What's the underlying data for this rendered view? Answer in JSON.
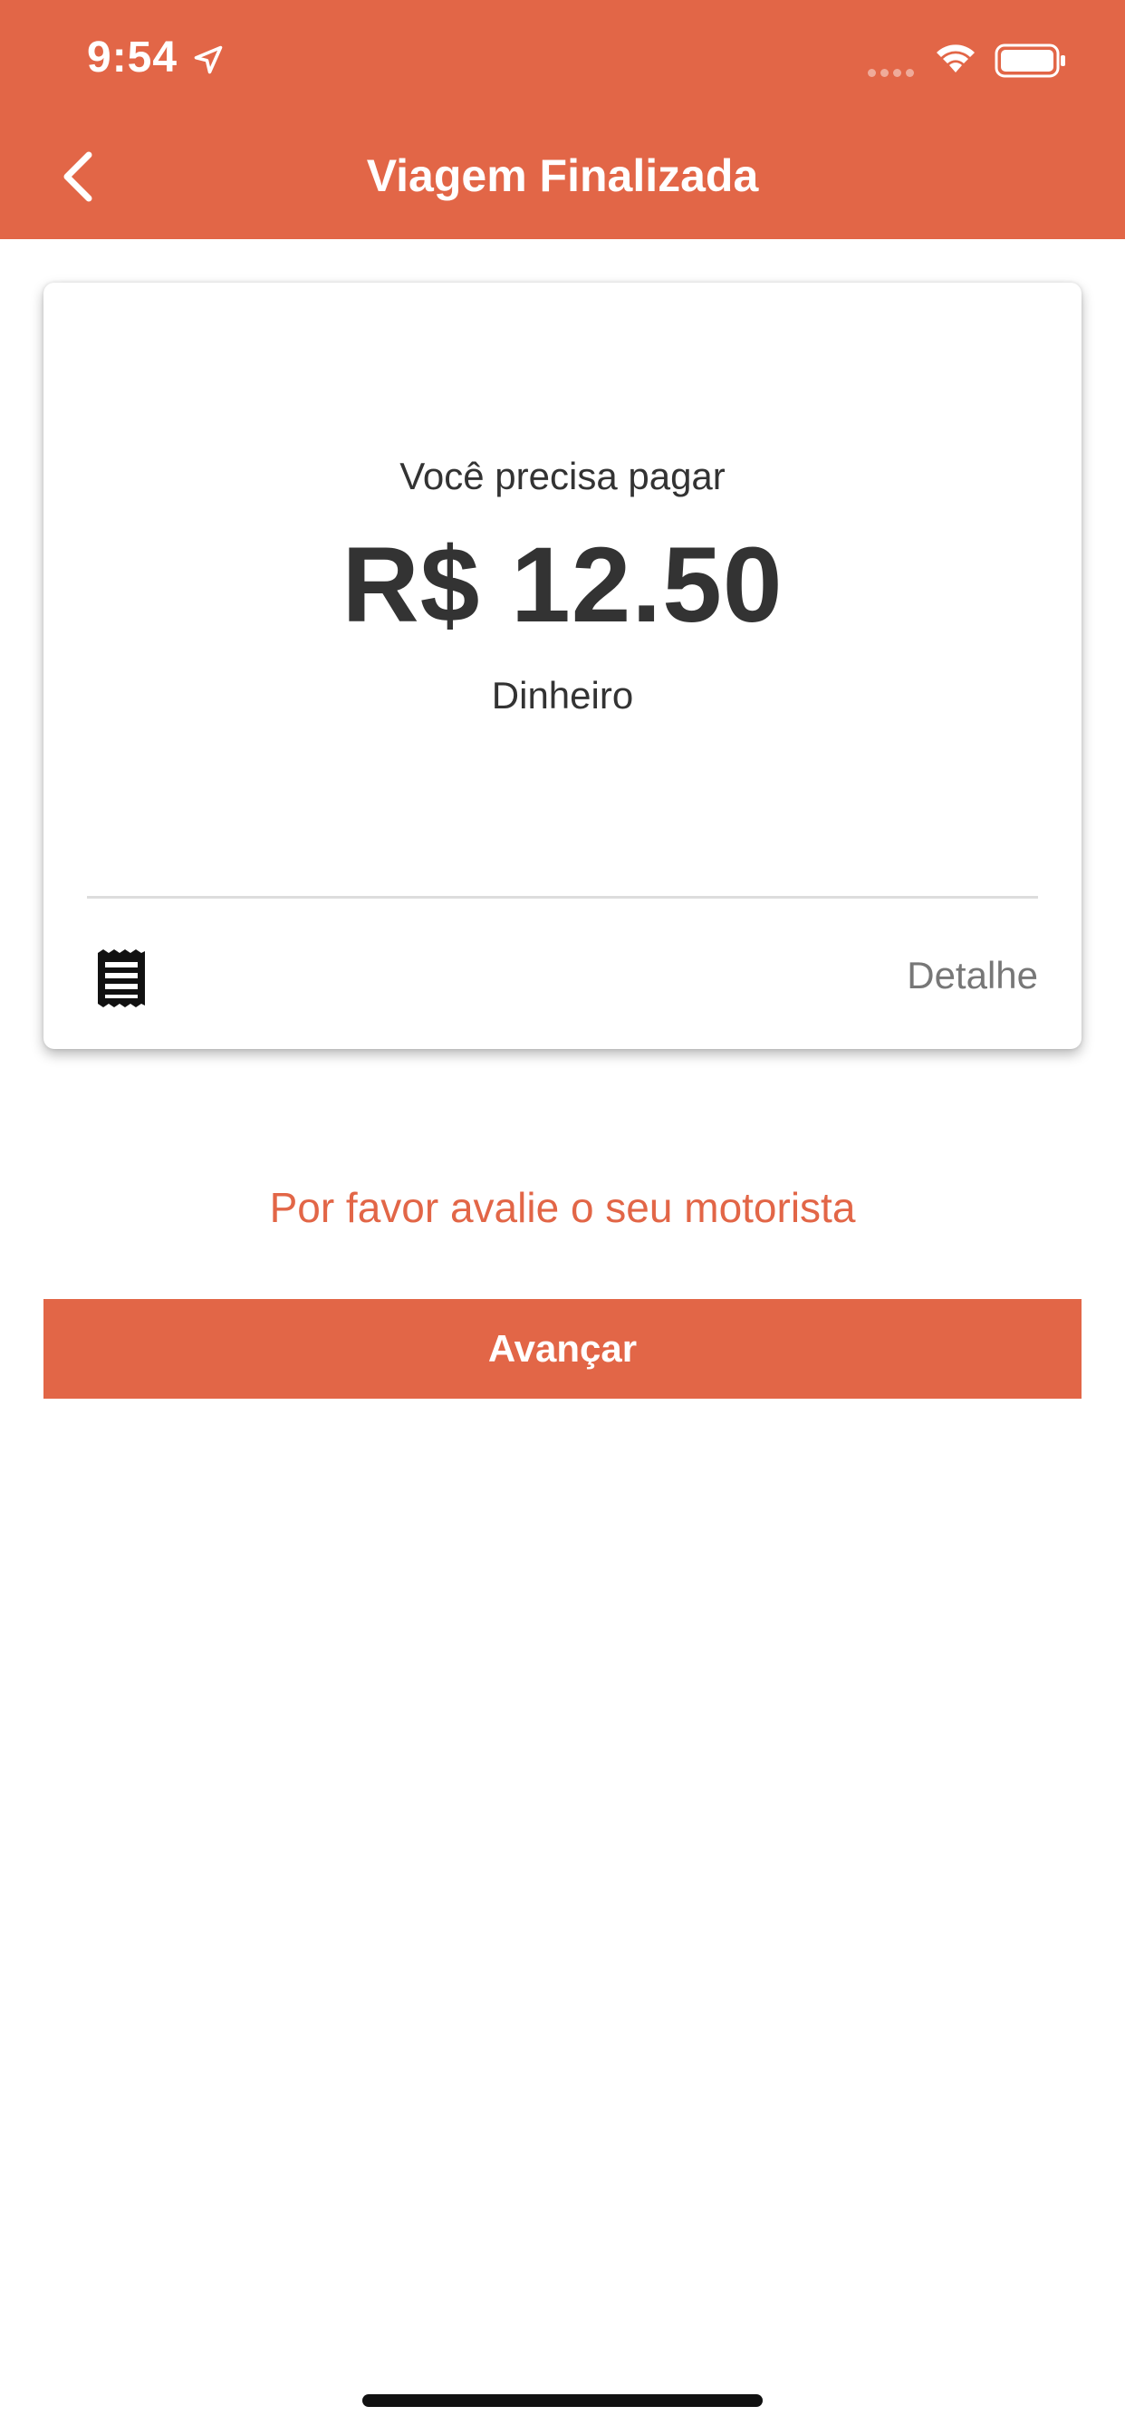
{
  "status_bar": {
    "time": "9:54",
    "location_icon": "location-arrow-icon",
    "wifi_icon": "wifi-icon",
    "battery_icon": "battery-icon"
  },
  "nav": {
    "title": "Viagem Finalizada",
    "back_icon": "chevron-left-icon"
  },
  "card": {
    "pay_label": "Você precisa pagar",
    "amount": "R$ 12.50",
    "method": "Dinheiro",
    "receipt_icon": "receipt-icon",
    "detail_label": "Detalhe"
  },
  "rate_prompt": "Por favor avalie o seu motorista",
  "next_button": "Avançar",
  "colors": {
    "accent": "#E26647",
    "text": "#333333",
    "muted": "#777777"
  }
}
